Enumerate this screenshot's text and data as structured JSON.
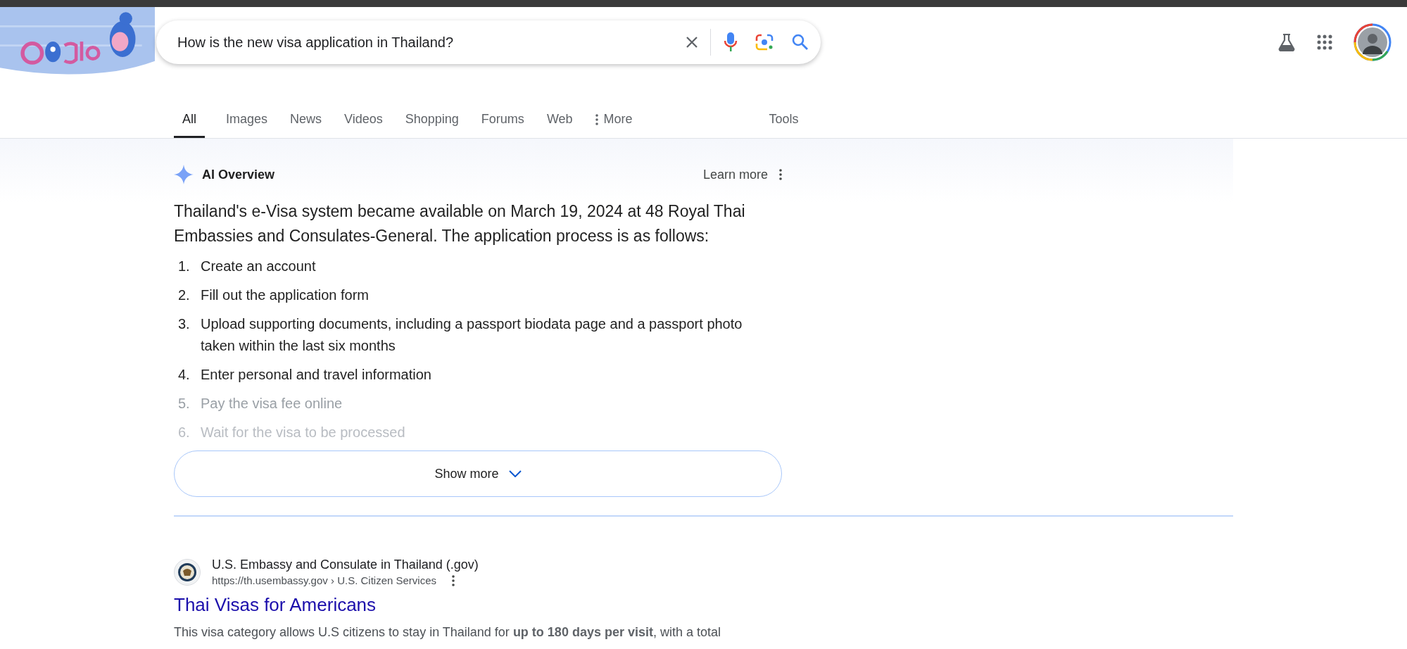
{
  "search": {
    "query": "How is the new visa application in Thailand?"
  },
  "tabs": [
    {
      "label": "All",
      "selected": true,
      "kind": "plain"
    },
    {
      "label": "Images",
      "selected": false,
      "kind": "plain"
    },
    {
      "label": "News",
      "selected": false,
      "kind": "plain"
    },
    {
      "label": "Videos",
      "selected": false,
      "kind": "plain"
    },
    {
      "label": "Shopping",
      "selected": false,
      "kind": "plain"
    },
    {
      "label": "Forums",
      "selected": false,
      "kind": "plain"
    },
    {
      "label": "Web",
      "selected": false,
      "kind": "plain"
    },
    {
      "label": "More",
      "selected": false,
      "kind": "menu"
    }
  ],
  "tools": "Tools",
  "ai_overview": {
    "title": "AI Overview",
    "learn_more": "Learn more",
    "summary": "Thailand's e-Visa system became available on March 19, 2024 at 48 Royal Thai Embassies and Consulates-General. The application process is as follows:",
    "steps": [
      {
        "number": "1.",
        "text": "Create an account",
        "kind": "plain"
      },
      {
        "number": "2.",
        "text": "Fill out the application form",
        "kind": "plain"
      },
      {
        "number": "3.",
        "text": "Upload supporting documents, including a passport biodata page and a passport photo taken within the last six months",
        "kind": "plain"
      },
      {
        "number": "4.",
        "text": "Enter personal and travel information",
        "kind": "plain"
      },
      {
        "number": "5.",
        "text": "Pay the visa fee online",
        "kind": "fading"
      },
      {
        "number": "6.",
        "text": "Wait for the visa to be processed",
        "kind": "faint"
      }
    ],
    "show_more": "Show more"
  },
  "results": [
    {
      "site": "U.S. Embassy and Consulate in Thailand (.gov)",
      "url": "https://th.usembassy.gov › U.S. Citizen Services",
      "title": "Thai Visas for Americans",
      "snippet": "This visa category allows U.S citizens to stay in Thailand for **up to 180 days per visit**, with a total"
    }
  ]
}
